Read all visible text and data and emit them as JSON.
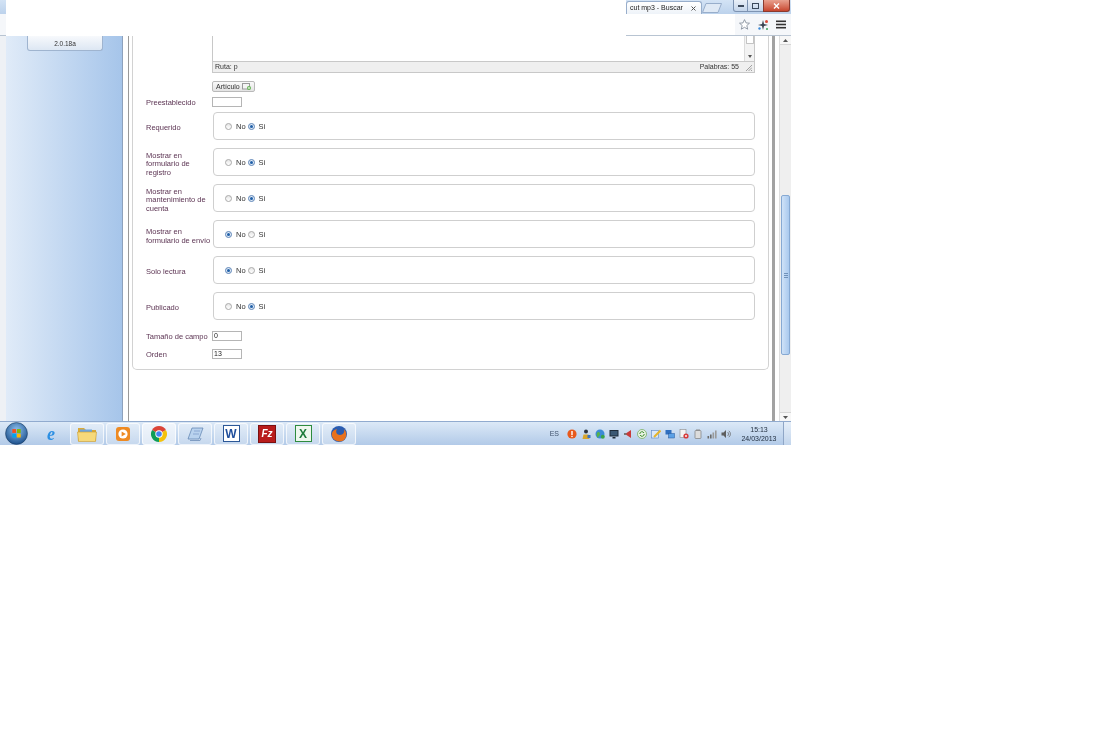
{
  "browser": {
    "tab": {
      "title": "cut mp3 - Buscar"
    }
  },
  "sidebar": {
    "version_button": "2.0.18a"
  },
  "editor": {
    "path": "Ruta: p",
    "word_count": "Palabras: 55"
  },
  "article_button": "Artículo",
  "fields": [
    {
      "kind": "text",
      "label": "Preestablecido"
    },
    {
      "kind": "radio",
      "label": "Requerido",
      "options": [
        {
          "label": "No",
          "selected": false
        },
        {
          "label": "Si",
          "selected": true
        }
      ]
    },
    {
      "kind": "radio",
      "label": "Mostrar en formulario de registro",
      "options": [
        {
          "label": "No",
          "selected": false
        },
        {
          "label": "Si",
          "selected": true
        }
      ]
    },
    {
      "kind": "radio",
      "label": "Mostrar en mantenimiento de cuenta",
      "options": [
        {
          "label": "No",
          "selected": false
        },
        {
          "label": "Si",
          "selected": true
        }
      ]
    },
    {
      "kind": "radio",
      "label": "Mostrar en formulario de envío",
      "options": [
        {
          "label": "No",
          "selected": true
        },
        {
          "label": "Si",
          "selected": false
        }
      ]
    },
    {
      "kind": "radio",
      "label": "Solo lectura",
      "options": [
        {
          "label": "No",
          "selected": true
        },
        {
          "label": "Si",
          "selected": false
        }
      ]
    },
    {
      "kind": "radio",
      "label": "Publicado",
      "options": [
        {
          "label": "No",
          "selected": false
        },
        {
          "label": "Si",
          "selected": true
        }
      ]
    },
    {
      "kind": "text",
      "label": "Tamaño de campo",
      "value": "0"
    },
    {
      "kind": "text",
      "label": "Orden",
      "value": "13"
    }
  ],
  "taskbar": {
    "apps": [
      {
        "kind": "ie",
        "logo": "e",
        "running": false,
        "selected": false
      },
      {
        "kind": "folder",
        "running": true,
        "selected": false
      },
      {
        "kind": "player",
        "running": true,
        "selected": false
      },
      {
        "kind": "chrome",
        "running": true,
        "selected": true
      },
      {
        "kind": "notepad",
        "running": true,
        "selected": false
      },
      {
        "kind": "word",
        "logo": "W",
        "running": true,
        "selected": false
      },
      {
        "kind": "filezilla",
        "logo": "Fz",
        "running": true,
        "selected": false
      },
      {
        "kind": "excel",
        "logo": "X",
        "running": true,
        "selected": false
      },
      {
        "kind": "firefox",
        "running": true,
        "selected": false
      }
    ],
    "tray": {
      "language": "ES",
      "time": "15:13",
      "date": "24/03/2013"
    }
  }
}
